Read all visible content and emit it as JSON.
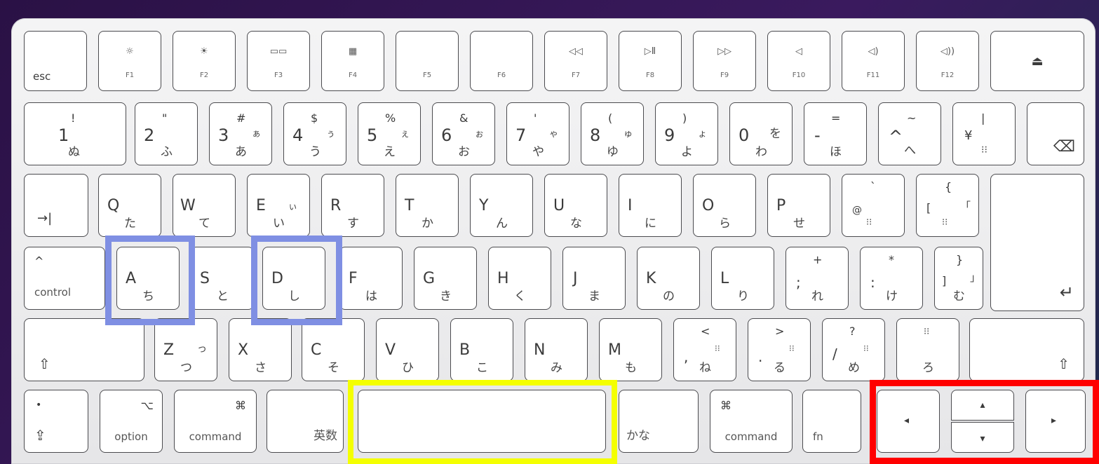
{
  "keyboard": {
    "function_row": [
      {
        "label": "esc",
        "icon": ""
      },
      {
        "label": "F1",
        "icon": "☼"
      },
      {
        "label": "F2",
        "icon": "☀"
      },
      {
        "label": "F3",
        "icon": "▭▭"
      },
      {
        "label": "F4",
        "icon": "▦"
      },
      {
        "label": "F5",
        "icon": ""
      },
      {
        "label": "F6",
        "icon": ""
      },
      {
        "label": "F7",
        "icon": "◁◁"
      },
      {
        "label": "F8",
        "icon": "▷Ⅱ"
      },
      {
        "label": "F9",
        "icon": "▷▷"
      },
      {
        "label": "F10",
        "icon": "◁"
      },
      {
        "label": "F11",
        "icon": "◁)"
      },
      {
        "label": "F12",
        "icon": "◁))"
      },
      {
        "label": "",
        "icon": "⏏"
      }
    ],
    "number_row": [
      {
        "top": "!",
        "main": "1",
        "kana_top": "",
        "kana": "ぬ"
      },
      {
        "top": "\"",
        "main": "2",
        "kana_top": "",
        "kana": "ふ"
      },
      {
        "top": "#",
        "main": "3",
        "kana_top": "ぁ",
        "kana": "あ"
      },
      {
        "top": "$",
        "main": "4",
        "kana_top": "ぅ",
        "kana": "う"
      },
      {
        "top": "%",
        "main": "5",
        "kana_top": "ぇ",
        "kana": "え"
      },
      {
        "top": "&",
        "main": "6",
        "kana_top": "ぉ",
        "kana": "お"
      },
      {
        "top": "'",
        "main": "7",
        "kana_top": "ゃ",
        "kana": "や"
      },
      {
        "top": "(",
        "main": "8",
        "kana_top": "ゅ",
        "kana": "ゆ"
      },
      {
        "top": ")",
        "main": "9",
        "kana_top": "ょ",
        "kana": "よ"
      },
      {
        "top": "",
        "main": "0",
        "kana_top": "を",
        "kana": "わ"
      },
      {
        "top": "=",
        "main": "-",
        "kana_top": "",
        "kana": "ほ"
      },
      {
        "top": "~",
        "main": "^",
        "kana_top": "",
        "kana": "へ"
      },
      {
        "top": "|",
        "main": "¥",
        "kana_top": "",
        "kana": "⁝⁝"
      },
      {
        "top": "",
        "main": "⌫",
        "kana_top": "",
        "kana": ""
      }
    ],
    "qwerty_row": [
      {
        "main": "→|",
        "kana": ""
      },
      {
        "main": "Q",
        "kana": "た"
      },
      {
        "main": "W",
        "kana": "て"
      },
      {
        "main": "E",
        "kana": "い",
        "kana_top": "ぃ"
      },
      {
        "main": "R",
        "kana": "す"
      },
      {
        "main": "T",
        "kana": "か"
      },
      {
        "main": "Y",
        "kana": "ん"
      },
      {
        "main": "U",
        "kana": "な"
      },
      {
        "main": "I",
        "kana": "に"
      },
      {
        "main": "O",
        "kana": "ら"
      },
      {
        "main": "P",
        "kana": "せ"
      },
      {
        "main": "@",
        "kana": "⁝⁝",
        "top": "`"
      },
      {
        "main": "[",
        "kana": "⁝⁝",
        "top": "{",
        "kana_top": "「"
      }
    ],
    "home_row": [
      {
        "top": "^",
        "main": "control",
        "kana": ""
      },
      {
        "main": "A",
        "kana": "ち"
      },
      {
        "main": "S",
        "kana": "と"
      },
      {
        "main": "D",
        "kana": "し"
      },
      {
        "main": "F",
        "kana": "は"
      },
      {
        "main": "G",
        "kana": "き"
      },
      {
        "main": "H",
        "kana": "く"
      },
      {
        "main": "J",
        "kana": "ま"
      },
      {
        "main": "K",
        "kana": "の"
      },
      {
        "main": "L",
        "kana": "り"
      },
      {
        "top": "+",
        "main": ";",
        "kana": "れ"
      },
      {
        "top": "*",
        "main": ":",
        "kana": "け"
      },
      {
        "top": "}",
        "main": "]",
        "kana": "む",
        "kana_top": "」"
      },
      {
        "main": "↵",
        "kana": ""
      }
    ],
    "shift_row": [
      {
        "main": "⇧",
        "kana": ""
      },
      {
        "main": "Z",
        "kana": "つ",
        "kana_top": "っ"
      },
      {
        "main": "X",
        "kana": "さ"
      },
      {
        "main": "C",
        "kana": "そ"
      },
      {
        "main": "V",
        "kana": "ひ"
      },
      {
        "main": "B",
        "kana": "こ"
      },
      {
        "main": "N",
        "kana": "み"
      },
      {
        "main": "M",
        "kana": "も"
      },
      {
        "top": "<",
        "main": ",",
        "kana": "ね",
        "kana_top": "⁝⁝"
      },
      {
        "top": ">",
        "main": ".",
        "kana": "る",
        "kana_top": "⁝⁝"
      },
      {
        "top": "?",
        "main": "/",
        "kana": "め",
        "kana_top": "⁝⁝"
      },
      {
        "top": "⁝⁝",
        "main": "",
        "kana": "ろ"
      },
      {
        "main": "⇧",
        "kana": ""
      }
    ],
    "bottom_row": {
      "fn_globe_top": "•",
      "fn_globe": "⇪",
      "option_icon": "⌥",
      "option": "option",
      "command_icon": "⌘",
      "command": "command",
      "eisu": "英数",
      "space": "",
      "kana": "かな",
      "command_right_icon": "⌘",
      "command_right": "command",
      "fn": "fn",
      "arrow_left": "◂",
      "arrow_up": "▴",
      "arrow_down": "▾",
      "arrow_right": "▸"
    }
  },
  "highlights": {
    "blue": "#7f8fe3",
    "yellow": "#f4ff00",
    "red": "#ff0000"
  }
}
